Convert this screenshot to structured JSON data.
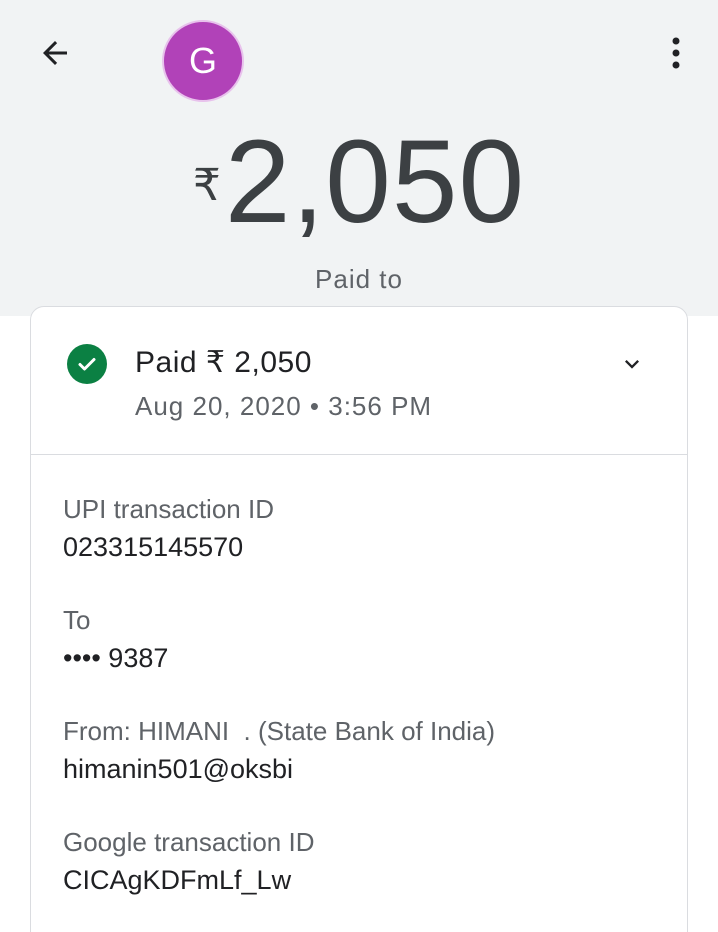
{
  "header": {
    "avatar_letter": "G",
    "currency_symbol": "₹",
    "amount": "2,050",
    "paid_to_label": "Paid to"
  },
  "status": {
    "title": "Paid ₹ 2,050",
    "date": "Aug 20, 2020 • 3:56 PM",
    "icon": "check-circle-icon",
    "color": "#0b8043"
  },
  "details": [
    {
      "label": "UPI transaction ID",
      "value": "023315145570"
    },
    {
      "label": "To",
      "value": "•••• 9387"
    },
    {
      "label": "From: HIMANI  . (State Bank of India)",
      "value": "himanin501@oksbi"
    },
    {
      "label": "Google transaction ID",
      "value": "CICAgKDFmLf_Lw"
    }
  ],
  "colors": {
    "avatar": "#b142b8",
    "header_background": "#f1f3f4"
  }
}
